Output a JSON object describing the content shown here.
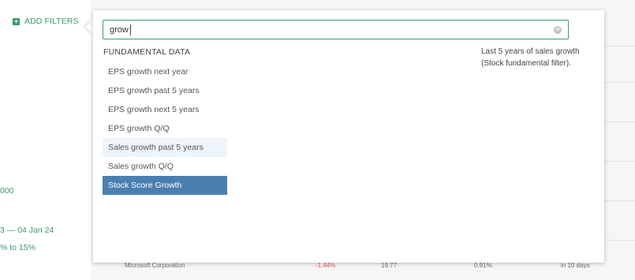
{
  "left_panel": {
    "add_filters_label": "ADD FILTERS",
    "add_filters_icon": "plus-icon",
    "values": [
      "000",
      "3 — 04 Jan 24",
      "% to 15%"
    ]
  },
  "search": {
    "value": "grow",
    "clear_icon": "clear-circle-icon"
  },
  "section": {
    "title": "FUNDAMENTAL DATA"
  },
  "options": [
    {
      "label": "EPS growth next year",
      "state": "normal"
    },
    {
      "label": "EPS growth past 5 years",
      "state": "normal"
    },
    {
      "label": "EPS growth next 5 years",
      "state": "normal"
    },
    {
      "label": "EPS growth Q/Q",
      "state": "normal"
    },
    {
      "label": "Sales growth past 5 years",
      "state": "hover"
    },
    {
      "label": "Sales growth Q/Q",
      "state": "normal"
    },
    {
      "label": "Stock Score Growth",
      "state": "selected"
    }
  ],
  "description": {
    "text": "Last 5 years of sales growth (Stock fundamental filter)."
  },
  "background_row": {
    "company": "Microsoft Corporation",
    "change": "-1.44%",
    "pe": "19.77",
    "yield": "0.91%",
    "earnings": "in 10 days"
  },
  "colors": {
    "accent_green": "#3b9a6a",
    "selected_blue": "#4a7fb0",
    "hover_blue": "#edf5fb",
    "negative_red": "#e05a6a"
  }
}
